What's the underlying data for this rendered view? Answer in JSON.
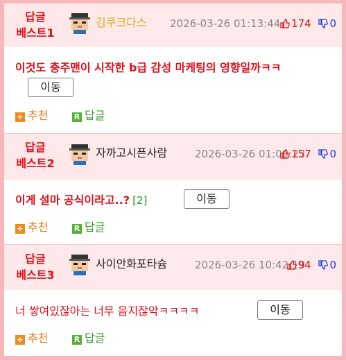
{
  "posts": [
    {
      "best_line1": "답글",
      "best_line2": "베스트1",
      "nickname": "김쿠크다스",
      "date": "2026-03-26 01:13:44",
      "up": "174",
      "down": "0",
      "content": "이것도 충주맨이 시작한 b급 감성 마케팅의 영향일까ㅋㅋ",
      "reply_count": "",
      "move_label": "이동",
      "recommend_label": "추천",
      "reply_label": "답글"
    },
    {
      "best_line1": "답글",
      "best_line2": "베스트2",
      "nickname": "자까고시픈사람",
      "date": "2026-03-26 01:09:23",
      "up": "157",
      "down": "0",
      "content": "이게 설마 공식이라고..?",
      "reply_count": "[2]",
      "move_label": "이동",
      "recommend_label": "추천",
      "reply_label": "답글"
    },
    {
      "best_line1": "답글",
      "best_line2": "베스트3",
      "nickname": "사이안화포타슘",
      "date": "2026-03-26 10:42:19",
      "up": "94",
      "down": "0",
      "content": "너 쌓여있잖아는 너무 음지잖악ㅋㅋㅋㅋ",
      "reply_count": "",
      "move_label": "이동",
      "recommend_label": "추천",
      "reply_label": "답글"
    }
  ],
  "icons": {
    "avatar": "pixel-avatar-icon",
    "thumbs_up": "thumbs-up-icon",
    "thumbs_down": "thumbs-down-icon",
    "recommend": "plus-icon",
    "reply": "reply-r-icon"
  },
  "colors": {
    "background": "#f8b7bb",
    "header_bg": "#fde8ea",
    "best_red": "#e0101c",
    "nick_gold": "#d7ae1d",
    "up_red": "#e0101c",
    "down_blue": "#1c3cd8",
    "recommend_orange": "#f08a1c",
    "reply_green": "#56b138"
  }
}
